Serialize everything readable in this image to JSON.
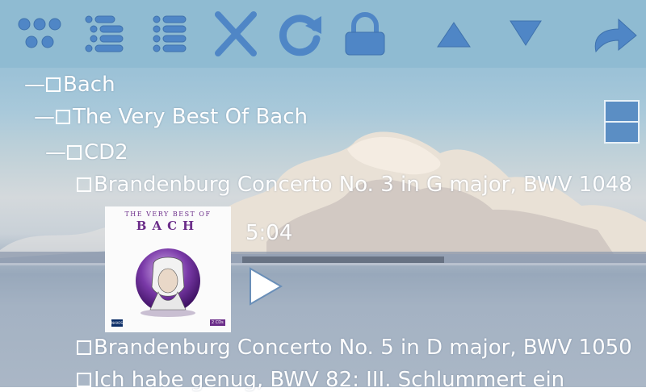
{
  "colors": {
    "toolbar_bg": "#8fbbd2",
    "icon_fill": "#4f86c6",
    "icon_stroke": "#3f72ad",
    "text": "#ffffff",
    "cover_accent": "#6c2e8a"
  },
  "toolbar": {
    "items": [
      {
        "icon": "grid-dots-icon",
        "label": ""
      },
      {
        "icon": "list-icon",
        "label": ""
      },
      {
        "icon": "list-icon",
        "label": ""
      },
      {
        "icon": "close-icon",
        "label": ""
      },
      {
        "icon": "refresh-icon",
        "label": ""
      },
      {
        "icon": "lock-icon",
        "label": ""
      },
      {
        "icon": "arrow-up-icon",
        "label": ""
      },
      {
        "icon": "arrow-down-icon",
        "label": ""
      },
      {
        "icon": "redo-arrow-icon",
        "label": ""
      }
    ]
  },
  "tree": {
    "artist": {
      "prefix": "—",
      "label": "Bach"
    },
    "album": {
      "prefix": "—",
      "label": "The Very Best Of Bach"
    },
    "disc": {
      "prefix": "—",
      "label": "CD2"
    },
    "tracks": [
      {
        "label": "Brandenburg Concerto No. 3 in G major, BWV 1048"
      },
      {
        "label": "Brandenburg Concerto No. 5 in D major, BWV 1050"
      },
      {
        "label": "Ich habe genug, BWV 82: III. Schlummert ein"
      }
    ]
  },
  "now_playing": {
    "duration": "5:04",
    "cover": {
      "line1": "THE VERY BEST OF",
      "line2": "BACH",
      "publisher": "NAXOS",
      "badge": "2 CDs"
    }
  }
}
